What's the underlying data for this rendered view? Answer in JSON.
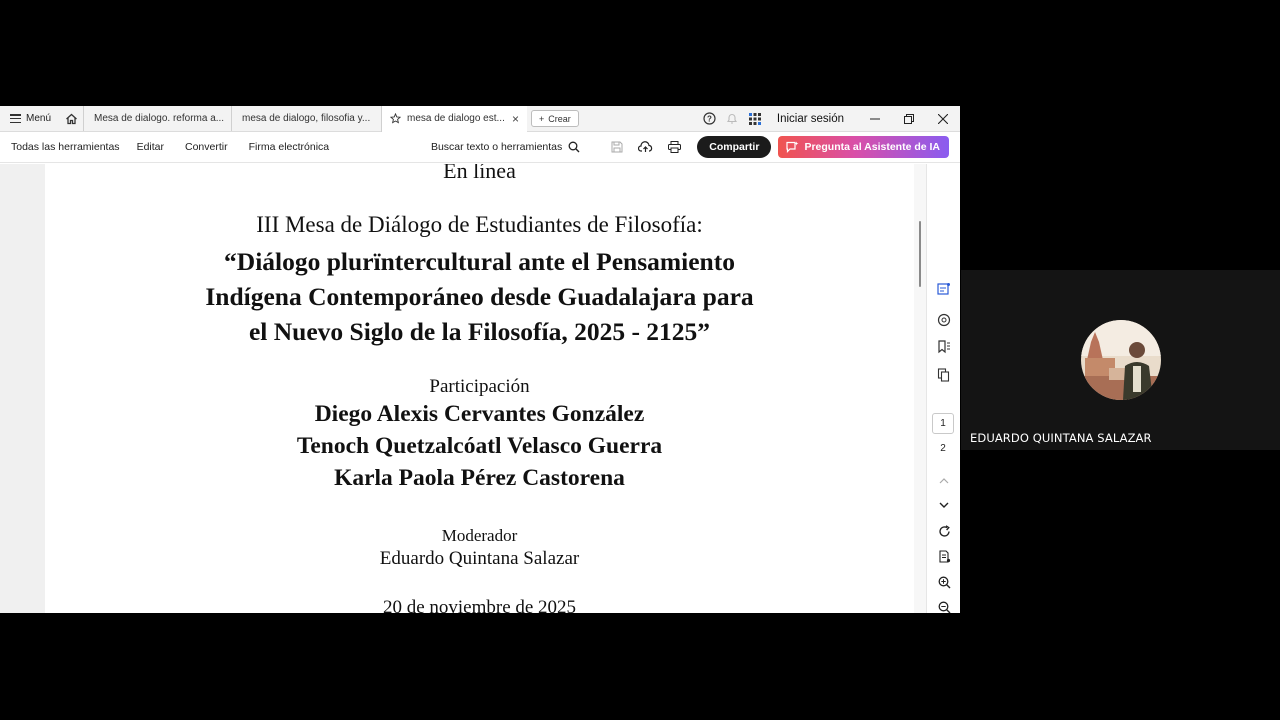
{
  "tabbar": {
    "menu_label": "Menú",
    "tabs": [
      {
        "label": "Mesa de dialogo. reforma a..."
      },
      {
        "label": "mesa de dialogo, filosofia y..."
      },
      {
        "label": "mesa de dialogo est..."
      }
    ],
    "create_label": "Crear",
    "signin_label": "Iniciar sesión"
  },
  "toolbar": {
    "items": [
      "Todas las herramientas",
      "Editar",
      "Convertir",
      "Firma electrónica"
    ],
    "search_label": "Buscar texto o herramientas",
    "share_label": "Compartir",
    "ai_label": "Pregunta al Asistente de IA"
  },
  "document": {
    "top_line": "En línea",
    "event_line": "III Mesa de Diálogo de Estudiantes de Filosofía:",
    "title_lines": [
      "“Diálogo plurïntercultural ante el Pensamiento",
      "Indígena Contemporáneo desde Guadalajara para",
      "el Nuevo Siglo de la Filosofía, 2025 - 2125”"
    ],
    "participation_label": "Participación",
    "participants": [
      "Diego Alexis Cervantes González",
      "Tenoch Quetzalcóatl Velasco Guerra",
      "Karla Paola Pérez Castorena"
    ],
    "moderator_label": "Moderador",
    "moderator_name": "Eduardo Quintana Salazar",
    "date": "20 de noviembre de 2025"
  },
  "pager": {
    "current": "1",
    "next": "2"
  },
  "meeting": {
    "participant_name": "EDUARDO QUINTANA SALAZAR"
  },
  "colors": {
    "share_button": "#1b1b1b",
    "ai_gradient_start": "#f0544f",
    "ai_gradient_end": "#8a5cf0",
    "background": "#000000"
  }
}
